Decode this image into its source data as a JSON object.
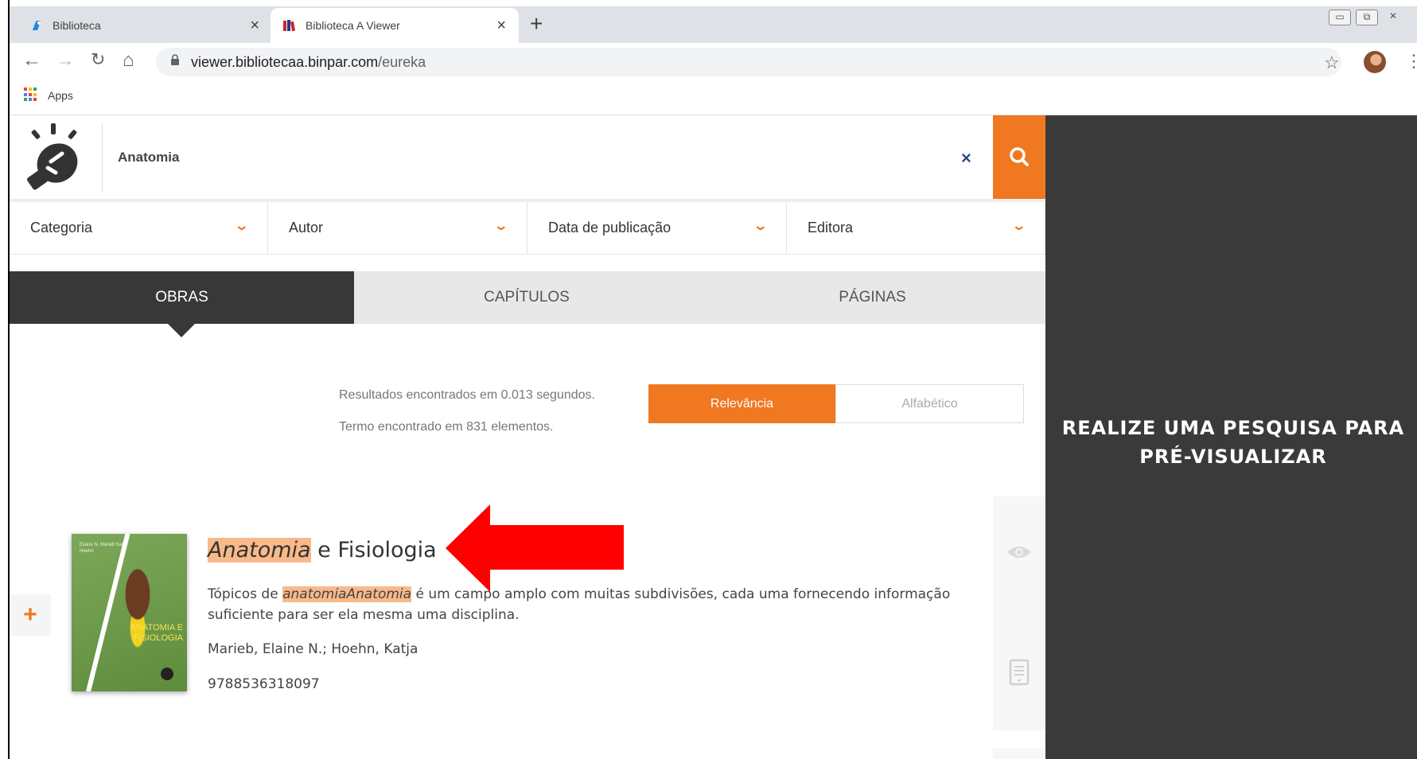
{
  "browser": {
    "tabs": [
      {
        "title": "Biblioteca",
        "close": "×"
      },
      {
        "title": "Biblioteca A Viewer",
        "close": "×"
      }
    ],
    "new_tab": "+",
    "url_host": "viewer.bibliotecaa.binpar.com",
    "url_path": "/eureka",
    "bookmarks": [
      {
        "label": "Apps"
      }
    ],
    "window_controls": [
      "▭",
      "⧉",
      "✕"
    ]
  },
  "search": {
    "query": "Anatomia",
    "clear": "×"
  },
  "filters": [
    {
      "label": "Categoria"
    },
    {
      "label": "Autor"
    },
    {
      "label": "Data de publicação"
    },
    {
      "label": "Editora"
    }
  ],
  "result_tabs": [
    {
      "label": "OBRAS",
      "active": true
    },
    {
      "label": "CAPÍTULOS",
      "active": false
    },
    {
      "label": "PÁGINAS",
      "active": false
    }
  ],
  "meta": {
    "time": "Resultados encontrados em 0.013 segundos.",
    "count": "Termo encontrado em 831 elementos."
  },
  "sort": {
    "relevance": "Relevância",
    "alphabetic": "Alfabético"
  },
  "result": {
    "title_highlight": "Anatomia",
    "title_rest": " e Fisiologia",
    "desc_prefix": "Tópicos de ",
    "desc_highlight": "anatomiaAnatomia",
    "desc_rest": " é um campo amplo com muitas subdivisões, cada uma fornecendo informação suficiente para ser ela mesma uma disciplina.",
    "authors": "Marieb, Elaine N.; Hoehn, Katja",
    "isbn": "9788536318097",
    "cover_title": "ANATOMIA E FISIOLOGIA",
    "cover_authors": "Elaine N. Marieb Katja Hoehn"
  },
  "add_button": "+",
  "preview": {
    "message": "REALIZE UMA PESQUISA PARA PRÉ-VISUALIZAR"
  },
  "colors": {
    "accent": "#f07820",
    "dark": "#383838",
    "panel": "#3a3a3a",
    "highlight": "#f9b98a",
    "arrow": "#ff0000"
  }
}
